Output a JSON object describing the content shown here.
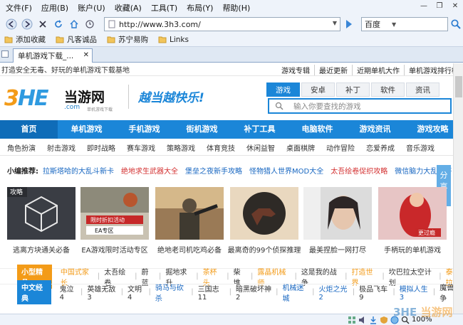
{
  "menu": [
    "文件(F)",
    "应用(B)",
    "账户(U)",
    "收藏(A)",
    "工具(T)",
    "布局(Y)",
    "帮助(H)"
  ],
  "toolbar": {
    "url": "http://www.3h3.com/",
    "search_engine": "百度"
  },
  "favorites": [
    "添加收藏",
    "凡客诚品",
    "苏宁易购",
    "Links"
  ],
  "tab": {
    "title": "单机游戏下载_..."
  },
  "site": {
    "top_left": "打造安全无毒、好玩的单机游戏下载基地",
    "top_links": [
      "游戏专辑",
      "最近更新",
      "近期单机大作",
      "单机游戏排行榜"
    ],
    "logo_prefix": "3",
    "logo_h": "HE",
    "logo_name": "当游网",
    "logo_domain": ".com",
    "logo_tagline": "单机游戏下载",
    "slogan": "越当越快乐!",
    "search_tabs": [
      "游戏",
      "安卓",
      "补丁",
      "软件",
      "资讯"
    ],
    "search_placeholder": "输入你要查找的游戏",
    "main_nav": [
      "首页",
      "单机游戏",
      "手机游戏",
      "街机游戏",
      "补丁工具",
      "电脑软件",
      "游戏资讯",
      "游戏攻略"
    ],
    "sub_nav": [
      "角色扮演",
      "射击游戏",
      "即时战略",
      "赛车游戏",
      "策略游戏",
      "体育竞技",
      "休闲益智",
      "桌面棋牌",
      "动作冒险",
      "恋爱养成",
      "音乐游戏"
    ],
    "recommend_label": "小编推荐:",
    "recommend": [
      {
        "text": "拉斯塔哈的大乱斗新卡",
        "color": "#1565c0"
      },
      {
        "text": "绝地求生武器大全",
        "color": "#d32f2f"
      },
      {
        "text": "堡垒之夜新手攻略",
        "color": "#1565c0"
      },
      {
        "text": "怪物猎人世界MOD大全",
        "color": "#1565c0"
      },
      {
        "text": "太吾绘卷促织攻略",
        "color": "#d32f2f"
      },
      {
        "text": "微信脑力大乱斗答",
        "color": "#1565c0"
      }
    ],
    "share": "分享",
    "cards": [
      {
        "caption": "逃离方块通关必备",
        "label": "攻略"
      },
      {
        "caption": "EA游戏限时活动专区",
        "label": "限时折扣活动",
        "sub": "EA专区"
      },
      {
        "caption": "绝地老司机吃鸡必备",
        "label": ""
      },
      {
        "caption": "最离奇的99个侦探推理",
        "label": ""
      },
      {
        "caption": "最美捏脸一网打尽",
        "label": ""
      },
      {
        "caption": "手柄玩的单机游戏",
        "label": "更过瘾"
      }
    ],
    "cat1": {
      "label": "小型精品",
      "items": [
        {
          "text": "中国式家长",
          "color": "#f39b18"
        },
        {
          "text": "太吾绘卷",
          "color": "#333"
        },
        {
          "text": "蔚蓝",
          "color": "#333"
        },
        {
          "text": "掘地求升",
          "color": "#333"
        },
        {
          "text": "茶杯头",
          "color": "#f39b18"
        },
        {
          "text": "柴堆",
          "color": "#333"
        },
        {
          "text": "露晶机械师",
          "color": "#f39b18"
        },
        {
          "text": "这是我的战争",
          "color": "#333"
        },
        {
          "text": "打造世界",
          "color": "#f39b18"
        },
        {
          "text": "坎巴拉太空计划",
          "color": "#333"
        },
        {
          "text": "泰拉",
          "color": "#f39b18"
        }
      ]
    },
    "cat2": {
      "label": "中文经典",
      "items": [
        {
          "text": "鬼泣4",
          "color": "#333"
        },
        {
          "text": "英雄无敌3",
          "color": "#333"
        },
        {
          "text": "文明4",
          "color": "#333"
        },
        {
          "text": "骑马与砍杀",
          "color": "#1565c0"
        },
        {
          "text": "三国志11",
          "color": "#333"
        },
        {
          "text": "暗黑破坏神2",
          "color": "#333"
        },
        {
          "text": "机械迷城",
          "color": "#1565c0"
        },
        {
          "text": "火炬之光2",
          "color": "#1565c0"
        },
        {
          "text": "极品飞车9",
          "color": "#333"
        },
        {
          "text": "模拟人生3",
          "color": "#1565c0"
        },
        {
          "text": "魔兽争",
          "color": "#333"
        }
      ]
    }
  },
  "status": {
    "zoom": "100%"
  },
  "watermark": {
    "a": "3HE",
    "b": "当游网"
  }
}
